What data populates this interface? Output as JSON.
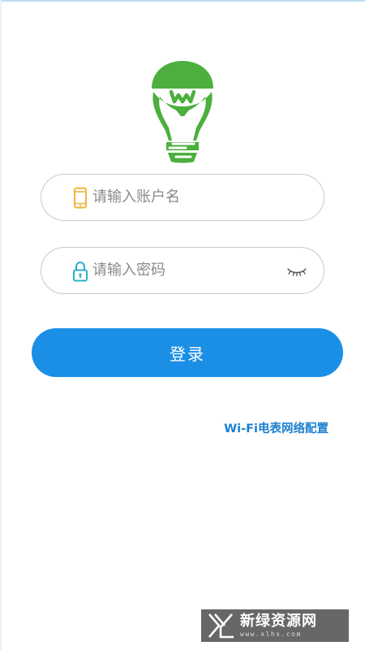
{
  "colors": {
    "accent": "#1b8fe6",
    "link": "#1c7fd0",
    "logo_green": "#4caf3e",
    "account_icon": "#f0b43c",
    "password_icon": "#29b0c9",
    "field_border": "#c9c9c9",
    "placeholder": "#8a8a8a"
  },
  "logo": {
    "icon": "lightbulb-hands-icon"
  },
  "account": {
    "icon": "phone-icon",
    "placeholder": "请输入账户名",
    "value": ""
  },
  "password": {
    "icon": "lock-icon",
    "placeholder": "请输入密码",
    "value": "",
    "toggle_icon": "eye-closed-icon"
  },
  "login_button": {
    "label": "登录"
  },
  "wifi_config": {
    "label": "Wi-Fi电表网络配置"
  },
  "watermark": {
    "icon": "xl-logo-mark",
    "title": "新绿资源网",
    "url": "www.xlhs.com"
  }
}
